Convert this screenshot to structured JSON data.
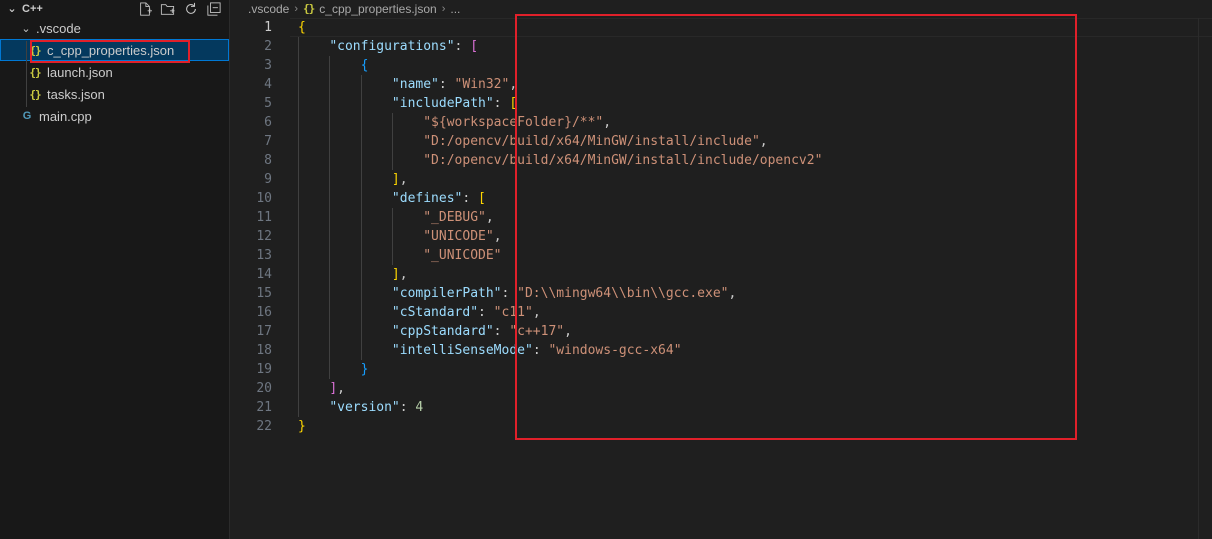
{
  "explorer": {
    "folder_name": "C++",
    "actions": [
      {
        "name": "new-file-icon",
        "glyph": "🗋"
      },
      {
        "name": "new-folder-icon",
        "glyph": "🗀"
      },
      {
        "name": "refresh-icon",
        "glyph": "↻"
      },
      {
        "name": "collapse-all-icon",
        "glyph": "⧉"
      }
    ],
    "vscode_folder": ".vscode",
    "files": [
      {
        "label": "c_cpp_properties.json",
        "icon": "json-file-icon",
        "glyph": "{}"
      },
      {
        "label": "launch.json",
        "icon": "json-file-icon",
        "glyph": "{}"
      },
      {
        "label": "tasks.json",
        "icon": "json-file-icon",
        "glyph": "{}"
      }
    ],
    "root_file": {
      "label": "main.cpp",
      "icon": "cpp-file-icon",
      "glyph": "G"
    }
  },
  "breadcrumb": {
    "folder": ".vscode",
    "file": "c_cpp_properties.json",
    "more": "...",
    "icon_glyph": "{}"
  },
  "editor": {
    "active_line": 1,
    "lines": [
      {
        "n": "1",
        "indent": 0,
        "tokens": [
          [
            "b1",
            "{"
          ]
        ]
      },
      {
        "n": "2",
        "indent": 1,
        "tokens": [
          [
            "k",
            "\"configurations\""
          ],
          [
            "p",
            ": "
          ],
          [
            "b2",
            "["
          ]
        ]
      },
      {
        "n": "3",
        "indent": 2,
        "tokens": [
          [
            "b3",
            "{"
          ]
        ]
      },
      {
        "n": "4",
        "indent": 3,
        "tokens": [
          [
            "k",
            "\"name\""
          ],
          [
            "p",
            ": "
          ],
          [
            "s",
            "\"Win32\""
          ],
          [
            "p",
            ","
          ]
        ]
      },
      {
        "n": "5",
        "indent": 3,
        "tokens": [
          [
            "k",
            "\"includePath\""
          ],
          [
            "p",
            ": "
          ],
          [
            "b1",
            "["
          ]
        ]
      },
      {
        "n": "6",
        "indent": 4,
        "tokens": [
          [
            "s",
            "\"${workspaceFolder}/**\""
          ],
          [
            "p",
            ","
          ]
        ]
      },
      {
        "n": "7",
        "indent": 4,
        "tokens": [
          [
            "s",
            "\"D:/opencv/build/x64/MinGW/install/include\""
          ],
          [
            "p",
            ","
          ]
        ]
      },
      {
        "n": "8",
        "indent": 4,
        "tokens": [
          [
            "s",
            "\"D:/opencv/build/x64/MinGW/install/include/opencv2\""
          ]
        ]
      },
      {
        "n": "9",
        "indent": 3,
        "tokens": [
          [
            "b1",
            "]"
          ],
          [
            "p",
            ","
          ]
        ]
      },
      {
        "n": "10",
        "indent": 3,
        "tokens": [
          [
            "k",
            "\"defines\""
          ],
          [
            "p",
            ": "
          ],
          [
            "b1",
            "["
          ]
        ]
      },
      {
        "n": "11",
        "indent": 4,
        "tokens": [
          [
            "s",
            "\"_DEBUG\""
          ],
          [
            "p",
            ","
          ]
        ]
      },
      {
        "n": "12",
        "indent": 4,
        "tokens": [
          [
            "s",
            "\"UNICODE\""
          ],
          [
            "p",
            ","
          ]
        ]
      },
      {
        "n": "13",
        "indent": 4,
        "tokens": [
          [
            "s",
            "\"_UNICODE\""
          ]
        ]
      },
      {
        "n": "14",
        "indent": 3,
        "tokens": [
          [
            "b1",
            "]"
          ],
          [
            "p",
            ","
          ]
        ]
      },
      {
        "n": "15",
        "indent": 3,
        "tokens": [
          [
            "k",
            "\"compilerPath\""
          ],
          [
            "p",
            ": "
          ],
          [
            "s",
            "\"D:\\\\mingw64\\\\bin\\\\gcc.exe\""
          ],
          [
            "p",
            ","
          ]
        ]
      },
      {
        "n": "16",
        "indent": 3,
        "tokens": [
          [
            "k",
            "\"cStandard\""
          ],
          [
            "p",
            ": "
          ],
          [
            "s",
            "\"c11\""
          ],
          [
            "p",
            ","
          ]
        ]
      },
      {
        "n": "17",
        "indent": 3,
        "tokens": [
          [
            "k",
            "\"cppStandard\""
          ],
          [
            "p",
            ": "
          ],
          [
            "s",
            "\"c++17\""
          ],
          [
            "p",
            ","
          ]
        ]
      },
      {
        "n": "18",
        "indent": 3,
        "tokens": [
          [
            "k",
            "\"intelliSenseMode\""
          ],
          [
            "p",
            ": "
          ],
          [
            "s",
            "\"windows-gcc-x64\""
          ]
        ]
      },
      {
        "n": "19",
        "indent": 2,
        "tokens": [
          [
            "b3",
            "}"
          ]
        ]
      },
      {
        "n": "20",
        "indent": 1,
        "tokens": [
          [
            "b2",
            "]"
          ],
          [
            "p",
            ","
          ]
        ]
      },
      {
        "n": "21",
        "indent": 1,
        "tokens": [
          [
            "k",
            "\"version\""
          ],
          [
            "p",
            ": "
          ],
          [
            "n",
            "4"
          ]
        ]
      },
      {
        "n": "22",
        "indent": 0,
        "tokens": [
          [
            "b1",
            "}"
          ]
        ]
      }
    ]
  },
  "colors": {
    "highlight_box": "#e0202a",
    "selection": "#04395e",
    "focus_border": "#0078d4"
  }
}
